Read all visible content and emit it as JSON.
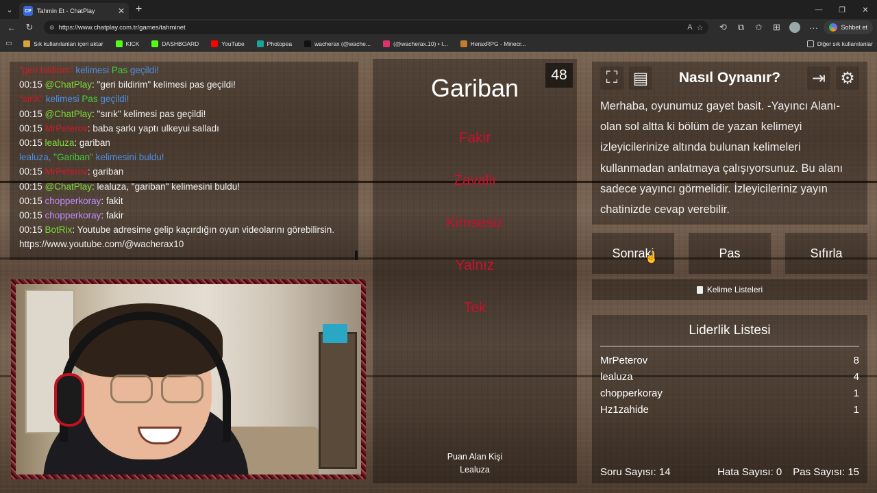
{
  "browser": {
    "tab_title": "Tahmin Et - ChatPlay",
    "tab_favicon": "CP",
    "url": "https://www.chatplay.com.tr/games/tahminet",
    "copilot_label": "Sohbet et",
    "bookmarks": [
      {
        "label": "Sık kullanılanları içeri aktar",
        "icon": "folder-icon",
        "color": "#d9a23b"
      },
      {
        "label": "KICK",
        "icon": "kick-icon",
        "color": "#53fc18"
      },
      {
        "label": "DASHBOARD",
        "icon": "kick-icon",
        "color": "#53fc18"
      },
      {
        "label": "YouTube",
        "icon": "youtube-icon",
        "color": "#ff0000"
      },
      {
        "label": "Photopea",
        "icon": "photopea-icon",
        "color": "#18a497"
      },
      {
        "label": "wacherax (@wache...",
        "icon": "tiktok-icon",
        "color": "#111111"
      },
      {
        "label": "(@wacherax.10) • I...",
        "icon": "instagram-icon",
        "color": "#e1306c"
      },
      {
        "label": "HeraxRPG - Minecr...",
        "icon": "herax-icon",
        "color": "#c47b2a"
      }
    ],
    "other_bookmarks": "Diğer sık kullanılanlar"
  },
  "chat": {
    "lines": [
      [
        {
          "t": "\"geri bildirim\"",
          "c": "c-red"
        },
        {
          "t": " kelimesi ",
          "c": "c-blue"
        },
        {
          "t": "Pas",
          "c": "c-green"
        },
        {
          "t": " geçildi!",
          "c": "c-blue"
        }
      ],
      [
        {
          "t": "00:15 ",
          "c": "c-white"
        },
        {
          "t": "@ChatPlay",
          "c": "c-lime"
        },
        {
          "t": ": \"geri bildirim\" kelimesi pas geçildi!",
          "c": "c-white"
        }
      ],
      [
        {
          "t": "\"sırık\"",
          "c": "c-red"
        },
        {
          "t": " kelimesi ",
          "c": "c-blue"
        },
        {
          "t": "Pas",
          "c": "c-green"
        },
        {
          "t": " geçildi!",
          "c": "c-blue"
        }
      ],
      [
        {
          "t": "00:15 ",
          "c": "c-white"
        },
        {
          "t": "@ChatPlay",
          "c": "c-lime"
        },
        {
          "t": ": \"sırık\" kelimesi pas geçildi!",
          "c": "c-white"
        }
      ],
      [
        {
          "t": "00:15 ",
          "c": "c-white"
        },
        {
          "t": "MrPeterov",
          "c": "c-red"
        },
        {
          "t": ": baba şarkı yaptı ulkeyui salladı",
          "c": "c-white"
        }
      ],
      [
        {
          "t": "00:15 ",
          "c": "c-white"
        },
        {
          "t": "lealuza",
          "c": "c-lime"
        },
        {
          "t": ": gariban",
          "c": "c-white"
        }
      ],
      [
        {
          "t": "lealuza, ",
          "c": "c-blue"
        },
        {
          "t": "\"Gariban\"",
          "c": "c-green"
        },
        {
          "t": " kelimesini buldu!",
          "c": "c-blue"
        }
      ],
      [
        {
          "t": "00:15 ",
          "c": "c-white"
        },
        {
          "t": "MrPeterov",
          "c": "c-red"
        },
        {
          "t": ": gariban",
          "c": "c-white"
        }
      ],
      [
        {
          "t": "00:15 ",
          "c": "c-white"
        },
        {
          "t": "@ChatPlay",
          "c": "c-lime"
        },
        {
          "t": ": lealuza, \"gariban\" kelimesini buldu!",
          "c": "c-white"
        }
      ],
      [
        {
          "t": "00:15 ",
          "c": "c-white"
        },
        {
          "t": "chopperkoray",
          "c": "c-purple"
        },
        {
          "t": ": fakit",
          "c": "c-white"
        }
      ],
      [
        {
          "t": "00:15 ",
          "c": "c-white"
        },
        {
          "t": "chopperkoray",
          "c": "c-purple"
        },
        {
          "t": ": fakir",
          "c": "c-white"
        }
      ],
      [
        {
          "t": "00:15 ",
          "c": "c-white"
        },
        {
          "t": "BotRix",
          "c": "c-lime"
        },
        {
          "t": ": Youtube adresime gelip kaçırdığın oyun videolarını görebilirsin.",
          "c": "c-white"
        }
      ],
      [
        {
          "t": "https://www.youtube.com/@wacherax10",
          "c": "c-white"
        }
      ]
    ]
  },
  "card": {
    "timer": "48",
    "word": "Gariban",
    "taboo": [
      "Fakir",
      "Zavallı",
      "Kimsesiz",
      "Yalnız",
      "Tek"
    ],
    "puan_label": "Puan Alan Kişi",
    "puan_user": "Lealuza"
  },
  "how": {
    "title": "Nasıl Oynanır?",
    "text": "Merhaba, oyunumuz gayet basit. -Yayıncı Alanı- olan sol altta ki bölüm de yazan kelimeyi izleyicilerinize altında bulunan kelimeleri kullanmadan anlatmaya çalışıyorsunuz. Bu alanı sadece yayıncı görmelidir. İzleyicileriniz yayın chatinizde cevap verebilir."
  },
  "buttons": {
    "next": "Sonraki",
    "pass": "Pas",
    "reset": "Sıfırla",
    "word_lists": "Kelime Listeleri"
  },
  "leaderboard": {
    "title": "Liderlik Listesi",
    "rows": [
      {
        "name": "MrPeterov",
        "score": "8"
      },
      {
        "name": "lealuza",
        "score": "4"
      },
      {
        "name": "chopperkoray",
        "score": "1"
      },
      {
        "name": "Hz1zahide",
        "score": "1"
      }
    ]
  },
  "stats": {
    "questions": "Soru Sayısı: 14",
    "errors": "Hata Sayısı: 0",
    "passes": "Pas Sayısı: 15"
  }
}
